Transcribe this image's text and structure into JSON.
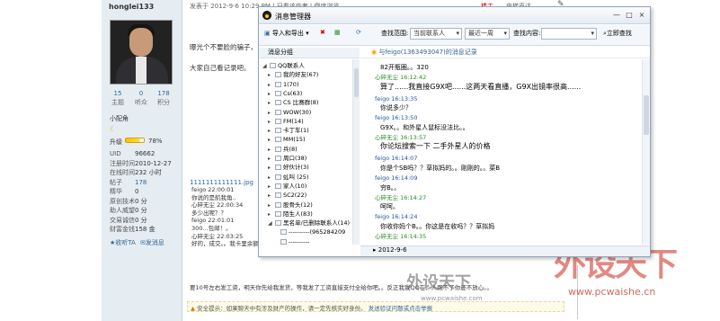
{
  "user": {
    "name": "honglei133",
    "stats": [
      {
        "num": "15",
        "label": "主题"
      },
      {
        "num": "0",
        "label": "听众"
      },
      {
        "num": "178",
        "label": "积分"
      }
    ],
    "title": "小配角",
    "level_label": "升级",
    "level_percent": "78%",
    "level_fraction": 0.78,
    "details": [
      {
        "k": "UID",
        "v": "96662"
      },
      {
        "k": "注册时间",
        "v": "2010-12-27"
      },
      {
        "k": "在线时间",
        "v": "232 小时"
      },
      {
        "k": "帖子",
        "v": "178"
      },
      {
        "k": "精华",
        "v": "0"
      },
      {
        "k": "原创技术",
        "v": "0 分"
      },
      {
        "k": "助人威望",
        "v": "0 分"
      },
      {
        "k": "交易诚信",
        "v": "0 分"
      },
      {
        "k": "财富金钱",
        "v": "158 金"
      }
    ],
    "collect": "收听TA",
    "message": "发消息"
  },
  "post": {
    "meta": "发表于 2012-9-6 10:29 PM  |  只看该作者  |  倒序浏览",
    "louzhu": "楼主",
    "diantai": "电梯直达",
    "line1": "曝光个不要脸的骗子，",
    "line2": "大家自己看记录吧。",
    "nums": "1111111111111.jpg",
    "quote_lines": [
      "feigo  22:00:01",
      "你说的是航我角..",
      "心碎无尘  22:00:34",
      "多少出呢？？",
      "feigo  22:01:01",
      "300...包邮！。",
      "心碎无尘  22:03:25",
      "好的，成交。。我卡里余额好像不够了。"
    ],
    "bottom": "要10号左右发工资，明天你先给我发货，等我发了工资直接支付全给你吧。。反正我我QQ在，人跑不了你还不放心。。",
    "notice_prefix": "安全提示：如果聊天中有涉及财产的操作，请一定先核实好身份。",
    "notice_link": "发送验证问题或点击举报"
  },
  "watermark": {
    "big": "外设天下",
    "url": "www.pcwaishe.cn",
    "small": "外设天下",
    "small_url": "www.pcwaishe.com"
  },
  "dialog": {
    "title": "消息管理器",
    "window_buttons": [
      "—",
      "□",
      "×"
    ],
    "toolbar": {
      "import_export": "导入和导出",
      "range_label": "查找范围:",
      "range_value": "当前联系人",
      "period_value": "最近一周",
      "content_label": "查找内容:",
      "search_btn": "立即查找"
    },
    "groups_header": "消息分组",
    "groups": [
      {
        "label": "QQ联系人",
        "arrow": "◢",
        "indent": 0
      },
      {
        "label": "我的好友(67)",
        "arrow": "▸",
        "indent": 1
      },
      {
        "label": "1(70)",
        "arrow": "▸",
        "indent": 1
      },
      {
        "label": "Cs(63)",
        "arrow": "▸",
        "indent": 1
      },
      {
        "label": "CS 比赛群(8)",
        "arrow": "▸",
        "indent": 1
      },
      {
        "label": "WOW(30)",
        "arrow": "▸",
        "indent": 1
      },
      {
        "label": "FM(14)",
        "arrow": "▸",
        "indent": 1
      },
      {
        "label": "卡丁车(1)",
        "arrow": "▸",
        "indent": 1
      },
      {
        "label": "MM(15)",
        "arrow": "▸",
        "indent": 1
      },
      {
        "label": "兵(8)",
        "arrow": "▸",
        "indent": 1
      },
      {
        "label": "周口(38)",
        "arrow": "▸",
        "indent": 1
      },
      {
        "label": "好伙计(3)",
        "arrow": "▸",
        "indent": 1
      },
      {
        "label": "虬叫 (25)",
        "arrow": "▸",
        "indent": 1
      },
      {
        "label": "家人(10)",
        "arrow": "▸",
        "indent": 1
      },
      {
        "label": "SC2(22)",
        "arrow": "▸",
        "indent": 1
      },
      {
        "label": "股骨头(12)",
        "arrow": "▸",
        "indent": 1
      },
      {
        "label": "陌生人(83)",
        "arrow": "▸",
        "indent": 1
      },
      {
        "label": "黑名单/已删除联系人(14)",
        "arrow": "◢",
        "indent": 1
      },
      {
        "label": "----------(965284209",
        "arrow": "",
        "indent": 2
      },
      {
        "label": "----------",
        "arrow": "",
        "indent": 2
      }
    ],
    "chat_header": "与feigo(1363493047)的消息记录",
    "messages": [
      {
        "type": "msg",
        "text": "82开瓶圈。。320"
      },
      {
        "type": "meta",
        "who": "me",
        "text": "心碎无尘 16:12:42"
      },
      {
        "type": "msg",
        "big": true,
        "text": "算了......我直接G9X吧......这两天看直播，G9X出镜率很高......"
      },
      {
        "type": "meta",
        "who": "other",
        "text": "feigo 16:13:35"
      },
      {
        "type": "msg",
        "text": "你说多少？"
      },
      {
        "type": "meta",
        "who": "other",
        "text": "feigo 16:13:50"
      },
      {
        "type": "msg",
        "text": "G9X。。和外星人鼠标没法比。。"
      },
      {
        "type": "meta",
        "who": "me",
        "text": "心碎无尘 16:13:57"
      },
      {
        "type": "msg",
        "big": true,
        "text": "你论坛搜索一下  二手外星人的价格"
      },
      {
        "type": "meta",
        "who": "other",
        "text": "feigo 16:14:07"
      },
      {
        "type": "msg",
        "text": "你是个SB吗？？草拟妈的。。刚刚的。。菜B"
      },
      {
        "type": "meta",
        "who": "other",
        "text": "feigo 16:14:09"
      },
      {
        "type": "msg",
        "text": "穷B。。"
      },
      {
        "type": "meta",
        "who": "me",
        "text": "心碎无尘 16:14:27"
      },
      {
        "type": "msg",
        "text": "呵呵。"
      },
      {
        "type": "meta",
        "who": "other",
        "text": "feigo 16:14:24"
      },
      {
        "type": "msg",
        "text": "你收你妈个B。。你这是在收吗？？草拟妈"
      },
      {
        "type": "meta",
        "who": "me",
        "text": "心碎无尘 16:14:35"
      }
    ],
    "footer_date": "2012-9-6"
  }
}
